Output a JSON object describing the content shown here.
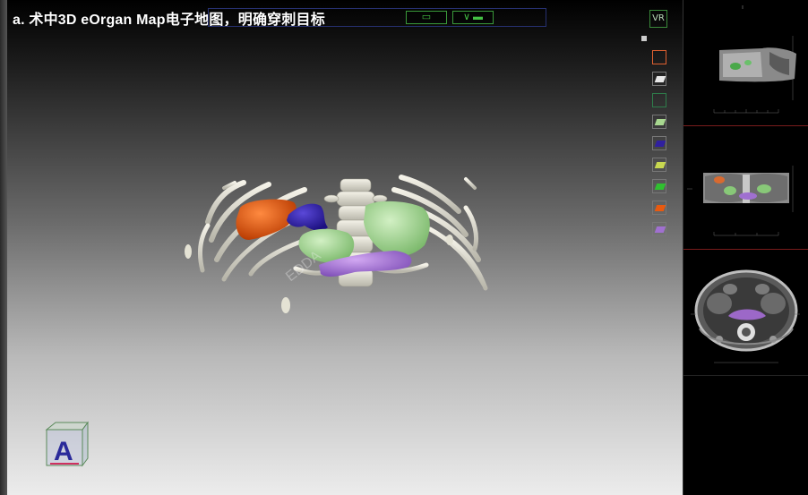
{
  "title": "a. 术中3D eOrgan Map电子地图，明确穿刺目标",
  "viewer": {
    "badge": "VR",
    "watermark": "EDDA"
  },
  "toolbar": {
    "btn1": "▭",
    "btn2": "∨ ▬"
  },
  "layers": [
    {
      "name": "outline-orange",
      "color": "#e06030",
      "filled": false
    },
    {
      "name": "white-solid",
      "color": "#e8e8e8",
      "filled": true
    },
    {
      "name": "outline-green",
      "color": "#2e7d4a",
      "filled": false
    },
    {
      "name": "light-green",
      "color": "#a8d890",
      "filled": true
    },
    {
      "name": "dark-blue",
      "color": "#3020a0",
      "filled": true
    },
    {
      "name": "yellow-green",
      "color": "#c8d850",
      "filled": true
    },
    {
      "name": "green",
      "color": "#30c030",
      "filled": true
    },
    {
      "name": "orange",
      "color": "#e85a10",
      "filled": true
    },
    {
      "name": "purple",
      "color": "#a070d0",
      "filled": true
    }
  ],
  "colors": {
    "kidney_left": "#e85a10",
    "vessel": "#3420a8",
    "organ_green": "#a6dc96",
    "organ_purple": "#a870d8",
    "bone": "#e4e2d4"
  }
}
